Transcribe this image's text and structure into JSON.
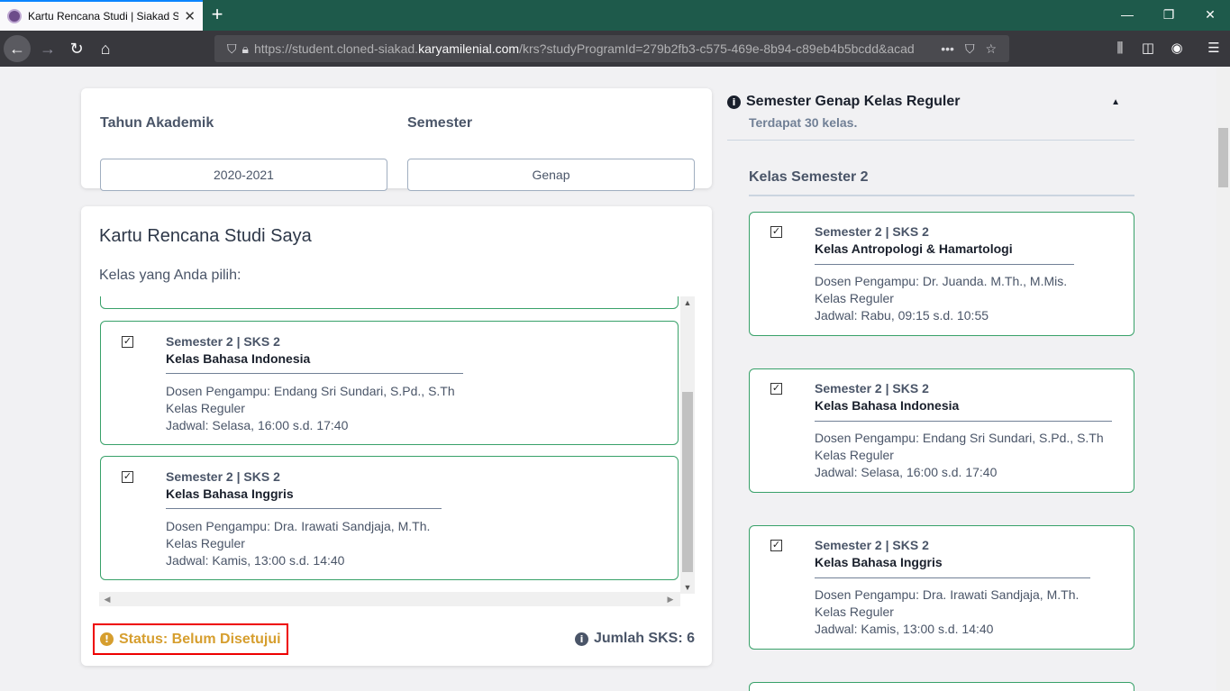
{
  "browser": {
    "tab_title": "Kartu Rencana Studi | Siakad ST",
    "url_prefix": "https://student.cloned-siakad.",
    "url_domain": "karyamilenial.com",
    "url_suffix": "/krs?studyProgramId=279b2fb3-c575-469e-8b94-c89eb4b5bcdd&acad"
  },
  "filter": {
    "year_label": "Tahun Akademik",
    "year_value": "2020-2021",
    "semester_label": "Semester",
    "semester_value": "Genap"
  },
  "krs": {
    "title": "Kartu Rencana Studi Saya",
    "subtitle": "Kelas yang Anda pilih:",
    "selected": [
      {
        "meta": "Semester 2 | SKS 2",
        "name": "Kelas Bahasa Indonesia",
        "dosen": "Dosen Pengampu: Endang Sri Sundari, S.Pd., S.Th",
        "type": "Kelas Reguler",
        "jadwal": "Jadwal: Selasa, 16:00 s.d. 17:40"
      },
      {
        "meta": "Semester 2 | SKS 2",
        "name": "Kelas Bahasa Inggris",
        "dosen": "Dosen Pengampu: Dra. Irawati Sandjaja, M.Th.",
        "type": "Kelas Reguler",
        "jadwal": "Jadwal: Kamis, 13:00 s.d. 14:40"
      }
    ],
    "status": "Status: Belum Disetujui",
    "total": "Jumlah SKS: 6"
  },
  "side": {
    "title": "Semester Genap Kelas Reguler",
    "subtitle": "Terdapat 30 kelas.",
    "semester_heading": "Kelas Semester 2",
    "classes": [
      {
        "meta": "Semester 2 | SKS 2",
        "name": "Kelas Antropologi & Hamartologi",
        "dosen": "Dosen Pengampu: Dr. Juanda. M.Th., M.Mis.",
        "type": "Kelas Reguler",
        "jadwal": "Jadwal: Rabu, 09:15 s.d. 10:55"
      },
      {
        "meta": "Semester 2 | SKS 2",
        "name": "Kelas Bahasa Indonesia",
        "dosen": "Dosen Pengampu: Endang Sri Sundari, S.Pd., S.Th",
        "type": "Kelas Reguler",
        "jadwal": "Jadwal: Selasa, 16:00 s.d. 17:40"
      },
      {
        "meta": "Semester 2 | SKS 2",
        "name": "Kelas Bahasa Inggris",
        "dosen": "Dosen Pengampu: Dra. Irawati Sandjaja, M.Th.",
        "type": "Kelas Reguler",
        "jadwal": "Jadwal: Kamis, 13:00 s.d. 14:40"
      }
    ]
  }
}
